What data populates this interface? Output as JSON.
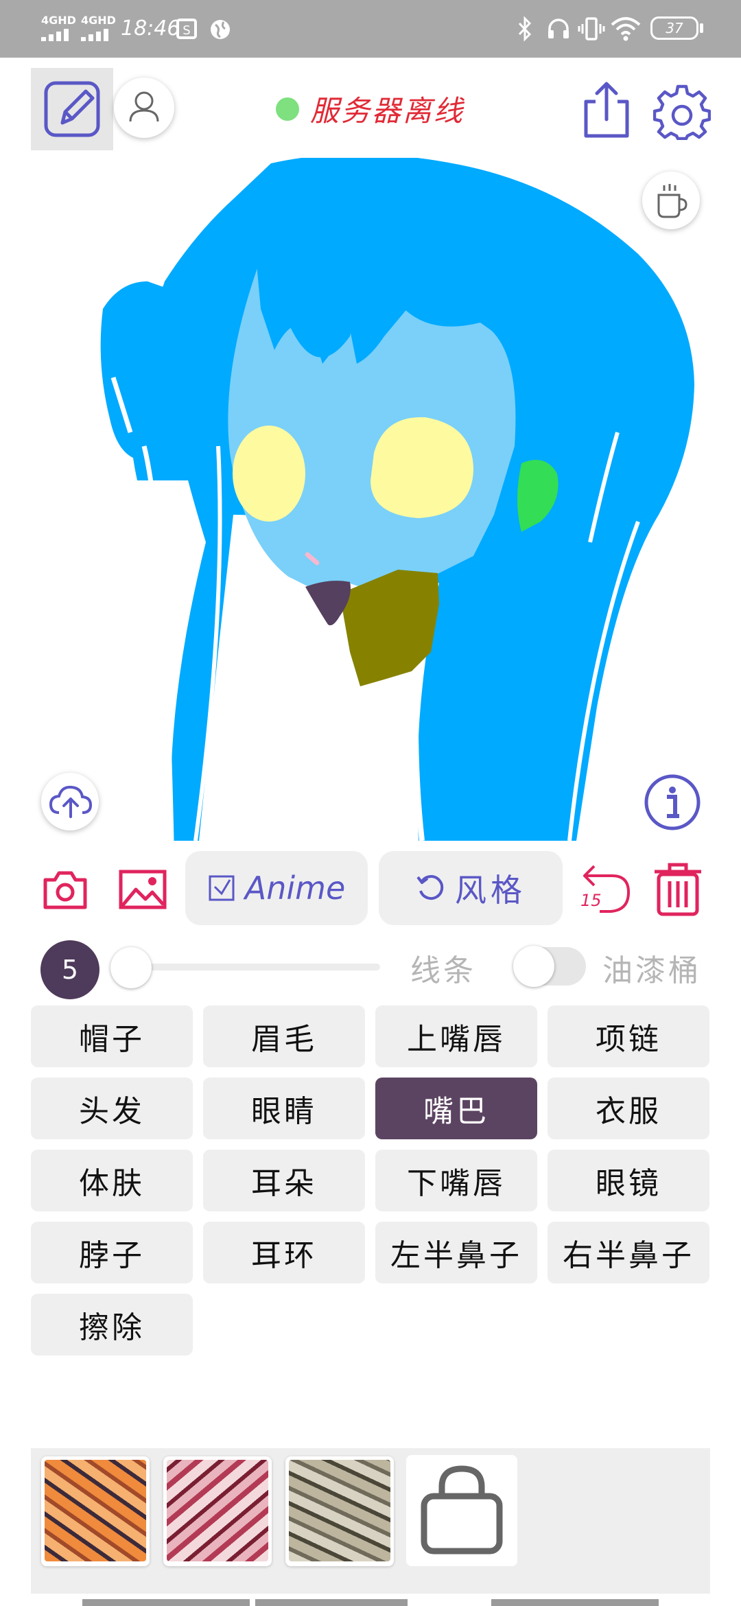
{
  "status_bar": {
    "network1": "4GHD",
    "network2": "4GHD",
    "time": "18:46",
    "battery": "37"
  },
  "top_bar": {
    "server_status": "服务器离线",
    "status_color": "#7ee07e"
  },
  "tools": {
    "model_label": "Anime",
    "style_label": "风格",
    "undo_count": "15"
  },
  "brush": {
    "size": "5",
    "line_label": "线条",
    "bucket_label": "油漆桶"
  },
  "parts": [
    {
      "label": "帽子"
    },
    {
      "label": "眉毛"
    },
    {
      "label": "上嘴唇"
    },
    {
      "label": "项链"
    },
    {
      "label": "头发"
    },
    {
      "label": "眼睛"
    },
    {
      "label": "嘴巴",
      "selected": true
    },
    {
      "label": "衣服"
    },
    {
      "label": "体肤"
    },
    {
      "label": "耳朵"
    },
    {
      "label": "下嘴唇"
    },
    {
      "label": "眼镜"
    },
    {
      "label": "脖子"
    },
    {
      "label": "耳环"
    },
    {
      "label": "左半鼻子"
    },
    {
      "label": "右半鼻子"
    },
    {
      "label": "擦除"
    }
  ],
  "colors": {
    "accent": "#5a57c6",
    "danger": "#e0245e",
    "selected_part": "#5b4461",
    "hair": "#00aaff",
    "skin": "#7ad0f8",
    "eyes": "#fdfaa0",
    "neck": "#868200",
    "ear": "#33dd55",
    "mouth": "#55405f"
  },
  "textures": [
    {
      "name": "orange-texture"
    },
    {
      "name": "red-texture"
    },
    {
      "name": "gray-texture"
    }
  ]
}
